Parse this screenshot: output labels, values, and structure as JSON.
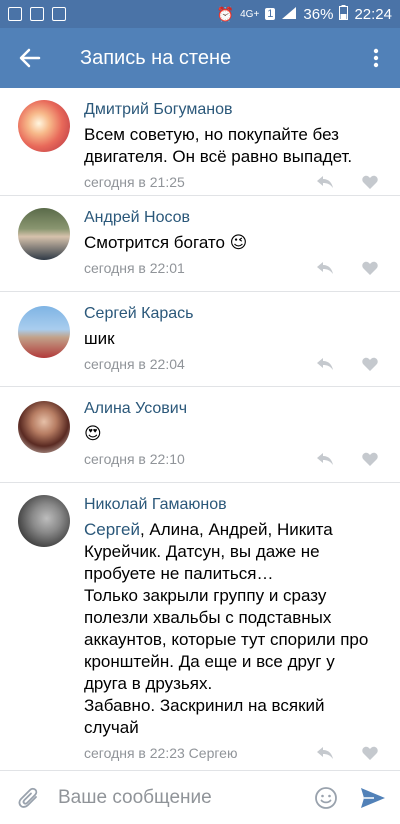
{
  "status_bar": {
    "battery": "36%",
    "time": "22:24",
    "network": "4G+",
    "sim": "1"
  },
  "app_bar": {
    "title": "Запись на стене"
  },
  "comments": [
    {
      "author": "Дмитрий Богуманов",
      "text": "Всем советую, но покупайте без двигателя. Он всё равно выпадет.",
      "time": "сегодня в 21:25"
    },
    {
      "author": "Андрей Носов",
      "text": "Смотрится богато 😉",
      "time": "сегодня в 22:01"
    },
    {
      "author": "Сергей Карась",
      "text": "шик",
      "time": "сегодня в 22:04"
    },
    {
      "author": "Алина Усович",
      "text": "😍",
      "time": "сегодня в 22:10"
    },
    {
      "author": "Николай Гамаюнов",
      "mention": "Сергей",
      "text": ", Алина, Андрей, Никита Курейчик. Датсун, вы даже не пробуете не палиться…\nТолько закрыли группу и сразу полезли хвальбы с подставных аккаунтов, которые тут спорили про кронштейн. Да еще и все друг у друга в друзьях.\nЗабавно. Заскринил на всякий случай",
      "time": "сегодня в 22:23 Сергею"
    }
  ],
  "composer": {
    "placeholder": "Ваше сообщение"
  },
  "colors": {
    "status_bar": "#4a73a7",
    "app_bar": "#5181b8",
    "author": "#2b587a",
    "meta": "#909499"
  }
}
